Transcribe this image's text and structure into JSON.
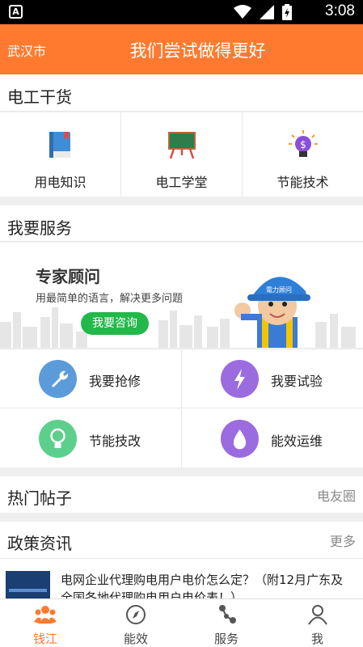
{
  "status_bar": {
    "time": "3:08",
    "left_badge": "A"
  },
  "header": {
    "city": "武汉市",
    "title": "我们尝试做得更好"
  },
  "tools": {
    "title": "电工干货",
    "items": [
      {
        "label": "用电知识",
        "icon": "book-icon"
      },
      {
        "label": "电工学堂",
        "icon": "blackboard-icon"
      },
      {
        "label": "节能技术",
        "icon": "lightbulb-icon"
      }
    ]
  },
  "services": {
    "title": "我要服务",
    "banner": {
      "heading": "专家顾问",
      "subtitle": "用最简单的语言，解决更多问题",
      "button": "我要咨询",
      "helmet_text": "電力顾问"
    },
    "items": [
      {
        "label": "我要抢修",
        "icon": "wrench-icon",
        "color": "#5b9bd9"
      },
      {
        "label": "我要试验",
        "icon": "lightning-icon",
        "color": "#9b6be0"
      },
      {
        "label": "节能技改",
        "icon": "bulb-icon",
        "color": "#5dcf8c"
      },
      {
        "label": "能效运维",
        "icon": "drop-icon",
        "color": "#9b6be0"
      }
    ]
  },
  "hot_posts": {
    "title": "热门帖子",
    "more": "电友圈"
  },
  "policy": {
    "title": "政策资讯",
    "more": "更多",
    "article": {
      "title": "电网企业代理购电用户电价怎么定？（附12月广东及全国各地代理购电用户电价表！）"
    }
  },
  "tabbar": {
    "tabs": [
      {
        "label": "钱江",
        "icon": "community-icon",
        "active": true
      },
      {
        "label": "能效",
        "icon": "compass-icon",
        "active": false
      },
      {
        "label": "服务",
        "icon": "share-nodes-icon",
        "active": false
      },
      {
        "label": "我",
        "icon": "person-icon",
        "active": false
      }
    ]
  },
  "colors": {
    "brand": "#ff7a2f",
    "green_button": "#22b84a"
  }
}
